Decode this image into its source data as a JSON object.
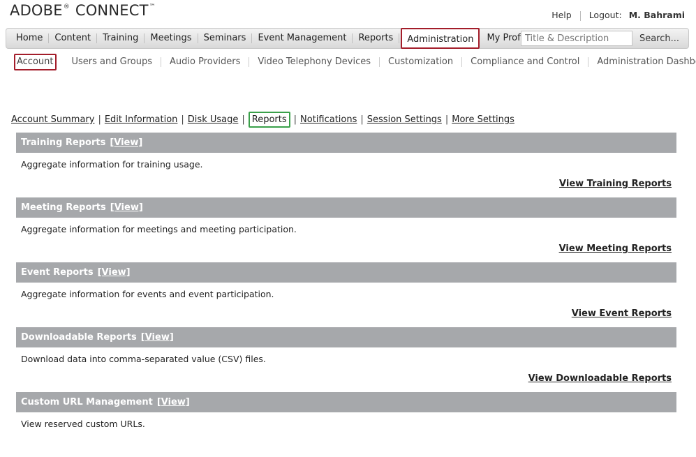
{
  "brand": {
    "name": "ADOBE",
    "reg": "®",
    "product": "CONNECT",
    "tm": "™"
  },
  "top_links": {
    "help": "Help",
    "logout_label": "Logout:",
    "user": "M. Bahrami"
  },
  "nav": {
    "items": [
      {
        "label": "Home"
      },
      {
        "label": "Content"
      },
      {
        "label": "Training"
      },
      {
        "label": "Meetings"
      },
      {
        "label": "Seminars"
      },
      {
        "label": "Event Management"
      },
      {
        "label": "Reports"
      },
      {
        "label": "Administration"
      },
      {
        "label": "My Profile"
      }
    ],
    "active": "Administration"
  },
  "search": {
    "placeholder": "Title & Description",
    "button": "Search..."
  },
  "subnav": {
    "items": [
      {
        "label": "Account"
      },
      {
        "label": "Users and Groups"
      },
      {
        "label": "Audio Providers"
      },
      {
        "label": "Video Telephony Devices"
      },
      {
        "label": "Customization"
      },
      {
        "label": "Compliance and Control"
      },
      {
        "label": "Administration Dashboard"
      }
    ],
    "active": "Account"
  },
  "tabs": {
    "items": [
      {
        "label": "Account Summary"
      },
      {
        "label": "Edit Information"
      },
      {
        "label": "Disk Usage"
      },
      {
        "label": "Reports"
      },
      {
        "label": "Notifications"
      },
      {
        "label": "Session Settings"
      },
      {
        "label": "More Settings"
      }
    ],
    "active": "Reports",
    "separator": "|"
  },
  "sections": [
    {
      "title": "Training Reports",
      "view": "[View]",
      "desc": "Aggregate information for training usage.",
      "link": "View Training Reports"
    },
    {
      "title": "Meeting Reports",
      "view": "[View]",
      "desc": "Aggregate information for meetings and meeting participation.",
      "link": "View Meeting Reports"
    },
    {
      "title": "Event Reports",
      "view": "[View]",
      "desc": "Aggregate information for events and event participation.",
      "link": "View Event Reports"
    },
    {
      "title": "Downloadable Reports",
      "view": "[View]",
      "desc": "Download data into comma-separated value (CSV) files.",
      "link": "View Downloadable Reports"
    },
    {
      "title": "Custom URL Management",
      "view": "[View]",
      "desc": "View reserved custom URLs.",
      "link": ""
    }
  ],
  "colors": {
    "active_border": "#a31d2a",
    "tab_active_border": "#3aa04a",
    "section_header": "#a6a8ab"
  }
}
